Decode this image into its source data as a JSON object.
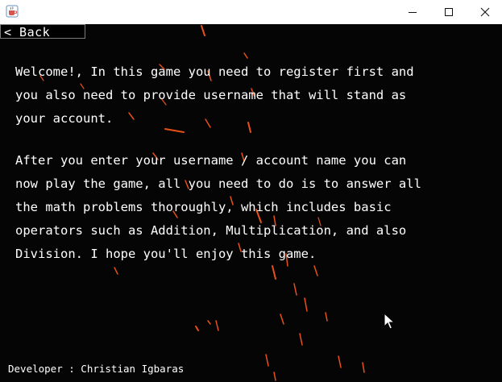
{
  "window": {
    "minimize_icon": "minimize-icon",
    "maximize_icon": "maximize-icon",
    "close_icon": "close-icon",
    "app_icon": "java-cup-icon"
  },
  "back_button": {
    "label": "< Back"
  },
  "welcome": {
    "paragraph1": "Welcome!, In this game you need to register first and\nyou also need to provide username that will stand as\nyour account.",
    "paragraph2": "After you enter your username / account name you can\nnow play the game, all you need to do is to answer all\nthe math problems thoroughly, which includes basic\noperators such as Addition, Multiplication, and also\nDivision. I hope you'll enjoy this game."
  },
  "footer": {
    "developer": "Developer : Christian Igbaras"
  },
  "colors": {
    "background": "#050505",
    "text": "#ffffff",
    "spark": "#e8501a"
  }
}
